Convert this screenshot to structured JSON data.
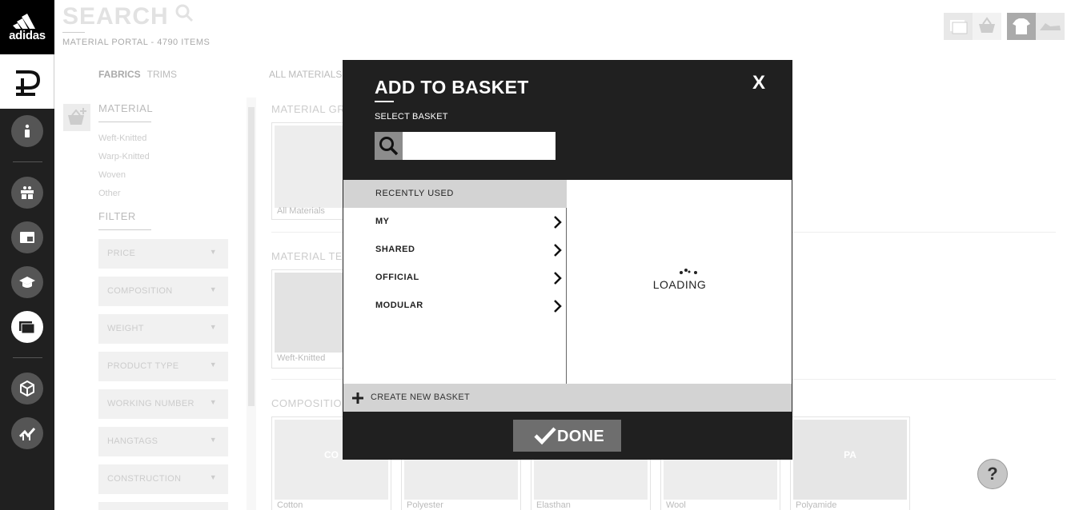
{
  "brand": {
    "logo_text": "adidas"
  },
  "header": {
    "search_title": "SEARCH",
    "portal_count": "MATERIAL PORTAL - 4790 ITEMS"
  },
  "tabs": [
    {
      "label": "FABRICS",
      "active": true
    },
    {
      "label": "TRIMS",
      "active": false
    }
  ],
  "breadcrumb": {
    "all_materials": "ALL MATERIALS"
  },
  "sidebar": {
    "material_heading": "MATERIAL",
    "material_items": [
      "Weft-Knitted",
      "Warp-Knitted",
      "Woven",
      "Other"
    ],
    "filter_heading": "FILTER",
    "filters": [
      "PRICE",
      "COMPOSITION",
      "WEIGHT",
      "PRODUCT TYPE",
      "WORKING NUMBER",
      "HANGTAGS",
      "CONSTRUCTION"
    ]
  },
  "sections": {
    "material_group": "MATERIAL GR",
    "material_tech": "MATERIAL TEC",
    "composition": "COMPOSITIO"
  },
  "tiles": {
    "group": [
      {
        "caption": "All Materials"
      }
    ],
    "tech": [
      {
        "caption": "Weft-Knitted"
      }
    ],
    "composition": [
      {
        "caption": "Cotton",
        "abbr": "CO"
      },
      {
        "caption": "Polyester",
        "abbr": ""
      },
      {
        "caption": "Elasthan",
        "abbr": ""
      },
      {
        "caption": "Wool",
        "abbr": ""
      },
      {
        "caption": "Polyamide",
        "abbr": "PA"
      }
    ]
  },
  "help": {
    "label": "?"
  },
  "modal": {
    "title": "ADD TO BASKET",
    "close_label": "X",
    "subtitle": "SELECT BASKET",
    "search": {
      "value": "",
      "placeholder": ""
    },
    "categories": [
      {
        "label": "RECENTLY USED",
        "selected": true
      },
      {
        "label": "MY",
        "selected": false
      },
      {
        "label": "SHARED",
        "selected": false
      },
      {
        "label": "OFFICIAL",
        "selected": false
      },
      {
        "label": "MODULAR",
        "selected": false
      }
    ],
    "loading_text": "LOADING",
    "create_label": "CREATE NEW BASKET",
    "done_label": "DONE"
  },
  "colors": {
    "modal_bg": "#202020",
    "rail_bg": "#202020",
    "selected_row": "#d3d3d3",
    "done_button": "#6e6e6e"
  }
}
